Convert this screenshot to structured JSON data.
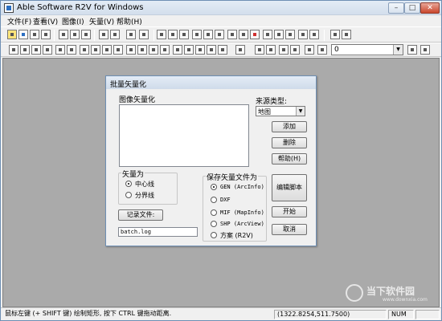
{
  "window": {
    "title": "Able Software R2V for Windows",
    "minimize_glyph": "–",
    "maximize_glyph": "□",
    "close_glyph": "✕"
  },
  "menu": [
    "文件(F)",
    "查看(V)",
    "图像(I)",
    "矢量(V)",
    "帮助(H)"
  ],
  "toolbar": {
    "layer_value": "0",
    "dropdown_glyph": "▼"
  },
  "dialog": {
    "title": "批量矢量化",
    "image_vectorize_label": "图像矢量化",
    "source_type_label": "来源类型:",
    "source_type_value": "地图",
    "buttons": {
      "add": "添加",
      "delete": "删除",
      "help": "帮助(H)",
      "edit_script": "编辑脚本",
      "start": "开始",
      "cancel": "取消",
      "log_file": "记录文件:"
    },
    "vector_as": {
      "caption": "矢量为",
      "options": [
        "中心线",
        "分界线"
      ],
      "selected": 0
    },
    "save_as": {
      "caption": "保存矢量文件为",
      "options": [
        "GEN (ArcInfo)",
        "DXF",
        "MIF (MapInfo)",
        "SHP (ArcView)",
        "方案 (R2V)"
      ],
      "selected": 0
    },
    "log_file_value": "batch.log"
  },
  "status": {
    "hint": "鼠标左键 (+ SHIFT 键) 绘制矩形, 按下 CTRL 键拖动距离.",
    "coords": "(1322.8254,511.7500)",
    "num": "NUM"
  },
  "watermark": {
    "text": "当下软件园",
    "url": "www.downxia.com"
  },
  "colors": {
    "workspace": "#aaaaaa",
    "titlebar": "#dce6f2",
    "close_button": "#c9462c"
  }
}
